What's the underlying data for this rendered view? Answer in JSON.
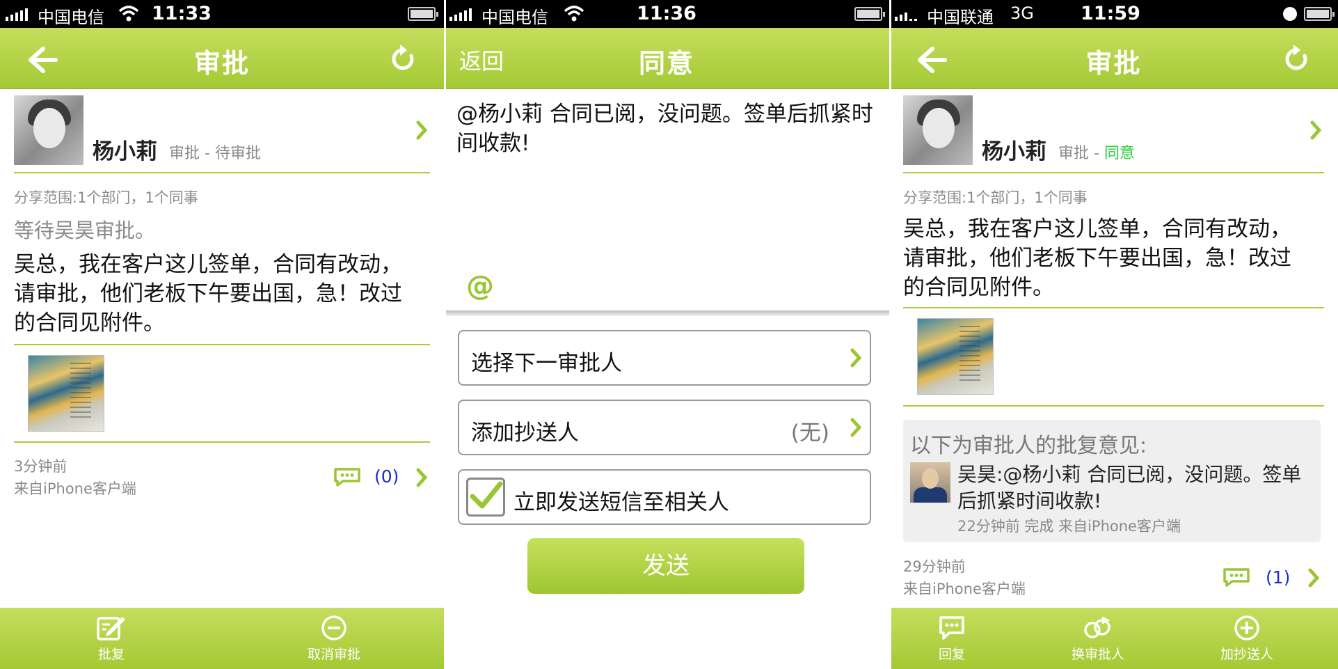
{
  "screen1": {
    "status": {
      "carrier": "中国电信",
      "time": "11:33"
    },
    "nav": {
      "title": "审批"
    },
    "sender": {
      "name": "杨小莉",
      "meta_prefix": "审批 - ",
      "meta_status": "待审批"
    },
    "scope": "分享范围:1个部门，1个同事",
    "waiting": "等待吴昊审批。",
    "body": "吴总，我在客户这儿签单，合同有改动，请审批，他们老板下午要出国，急！改过的合同见附件。",
    "time_ago": "3分钟前",
    "source": "来自iPhone客户端",
    "comment_count": "(0)",
    "tabs": [
      {
        "label": "批复",
        "icon": "edit-icon"
      },
      {
        "label": "取消审批",
        "icon": "minus-circle-icon"
      }
    ]
  },
  "screen2": {
    "status": {
      "carrier": "中国电信",
      "time": "11:36"
    },
    "nav": {
      "back_label": "返回",
      "title": "同意"
    },
    "compose_text": "@杨小莉 合同已阅，没问题。签单后抓紧时间收款!",
    "at_symbol": "@",
    "rows": {
      "next_approver": "选择下一审批人",
      "cc_label": "添加抄送人",
      "cc_value": "(无)",
      "sms_label": "立即发送短信至相关人"
    },
    "sms_checked": true,
    "send_label": "发送"
  },
  "screen3": {
    "status": {
      "carrier": "中国联通",
      "network": "3G",
      "time": "11:59"
    },
    "nav": {
      "title": "审批"
    },
    "sender": {
      "name": "杨小莉",
      "meta_prefix": "审批 - ",
      "meta_status": "同意"
    },
    "scope": "分享范围:1个部门，1个同事",
    "body": "吴总，我在客户这儿签单，合同有改动，请审批，他们老板下午要出国，急！改过的合同见附件。",
    "reply": {
      "heading": "以下为审批人的批复意见:",
      "text": "吴昊:@杨小莉 合同已阅，没问题。签单后抓紧时间收款!",
      "meta": "22分钟前 完成  来自iPhone客户端"
    },
    "time_ago": "29分钟前",
    "source": "来自iPhone客户端",
    "comment_count": "(1)",
    "tabs": [
      {
        "label": "回复",
        "icon": "reply-icon"
      },
      {
        "label": "换审批人",
        "icon": "swap-icon"
      },
      {
        "label": "加抄送人",
        "icon": "plus-circle-icon"
      }
    ]
  },
  "colors": {
    "accent": "#a9cc39",
    "nav_bg": "#b5d548",
    "approved": "#2ecc40",
    "count": "#1c2cd0",
    "meta_gray": "#8a8a8a"
  }
}
